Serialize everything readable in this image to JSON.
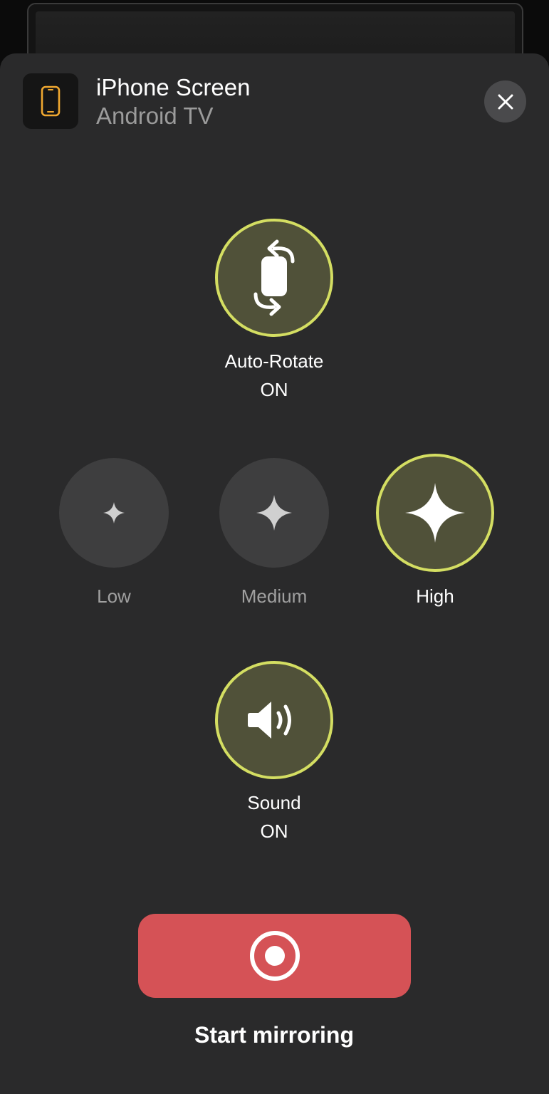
{
  "header": {
    "title": "iPhone Screen",
    "subtitle": "Android TV",
    "app_icon": "phone-icon",
    "close_icon": "close-icon"
  },
  "auto_rotate": {
    "label": "Auto-Rotate",
    "state": "ON",
    "icon": "rotate-icon"
  },
  "quality": {
    "options": [
      {
        "label": "Low",
        "icon": "sparkle-small-icon",
        "selected": false
      },
      {
        "label": "Medium",
        "icon": "sparkle-medium-icon",
        "selected": false
      },
      {
        "label": "High",
        "icon": "sparkle-large-icon",
        "selected": true
      }
    ]
  },
  "sound": {
    "label": "Sound",
    "state": "ON",
    "icon": "speaker-icon"
  },
  "action": {
    "label": "Start mirroring",
    "icon": "record-icon"
  },
  "colors": {
    "accent_ring": "#d4de62",
    "active_fill": "#505139",
    "record_button": "#d55256",
    "sheet_bg": "#2a2a2b",
    "app_icon_accent": "#f0a830"
  }
}
